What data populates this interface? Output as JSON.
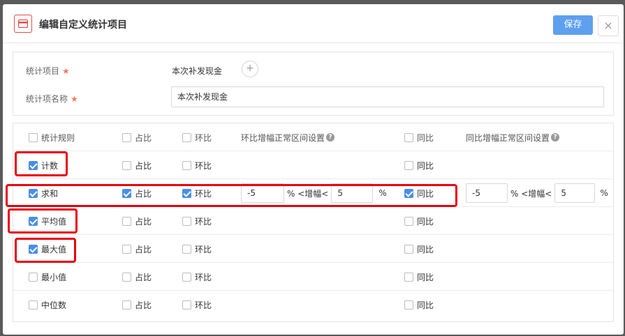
{
  "dialog": {
    "title": "编辑自定义统计项目",
    "save_label": "保存",
    "close_label": "×"
  },
  "form": {
    "item_label": "统计项目",
    "item_value": "本次补发现金",
    "add_label": "+",
    "name_label": "统计项名称",
    "name_value": "本次补发现金",
    "required_mark": "★"
  },
  "table": {
    "header": {
      "rule": "统计规则",
      "share": "占比",
      "mom": "环比",
      "mom_range": "环比增幅正常区间设置",
      "yoy": "同比",
      "yoy_range": "同比增幅正常区间设置",
      "help": "?"
    },
    "range_text": {
      "mid": "% <增幅<",
      "end": "%"
    },
    "rows": [
      {
        "rule": "计数",
        "rule_checked": true,
        "share": "占比",
        "share_checked": false,
        "mom": "环比",
        "mom_checked": false,
        "yoy": "同比",
        "yoy_checked": false
      },
      {
        "rule": "求和",
        "rule_checked": true,
        "share": "占比",
        "share_checked": true,
        "mom": "环比",
        "mom_checked": true,
        "yoy": "同比",
        "yoy_checked": true,
        "mom_min": "-5",
        "mom_max": "5",
        "yoy_min": "-5",
        "yoy_max": "5"
      },
      {
        "rule": "平均值",
        "rule_checked": true,
        "share": "占比",
        "share_checked": false,
        "mom": "环比",
        "mom_checked": false,
        "yoy": "同比",
        "yoy_checked": false
      },
      {
        "rule": "最大值",
        "rule_checked": true,
        "share": "占比",
        "share_checked": false,
        "mom": "环比",
        "mom_checked": false,
        "yoy": "同比",
        "yoy_checked": false
      },
      {
        "rule": "最小值",
        "rule_checked": false,
        "share": "占比",
        "share_checked": false,
        "mom": "环比",
        "mom_checked": false,
        "yoy": "同比",
        "yoy_checked": false
      },
      {
        "rule": "中位数",
        "rule_checked": false,
        "share": "占比",
        "share_checked": false,
        "mom": "环比",
        "mom_checked": false,
        "yoy": "同比",
        "yoy_checked": false
      }
    ]
  },
  "colors": {
    "accent": "#4a8fe7",
    "save_button": "#5ea0ef",
    "highlight": "#e8000f",
    "required": "#f07a5a"
  }
}
